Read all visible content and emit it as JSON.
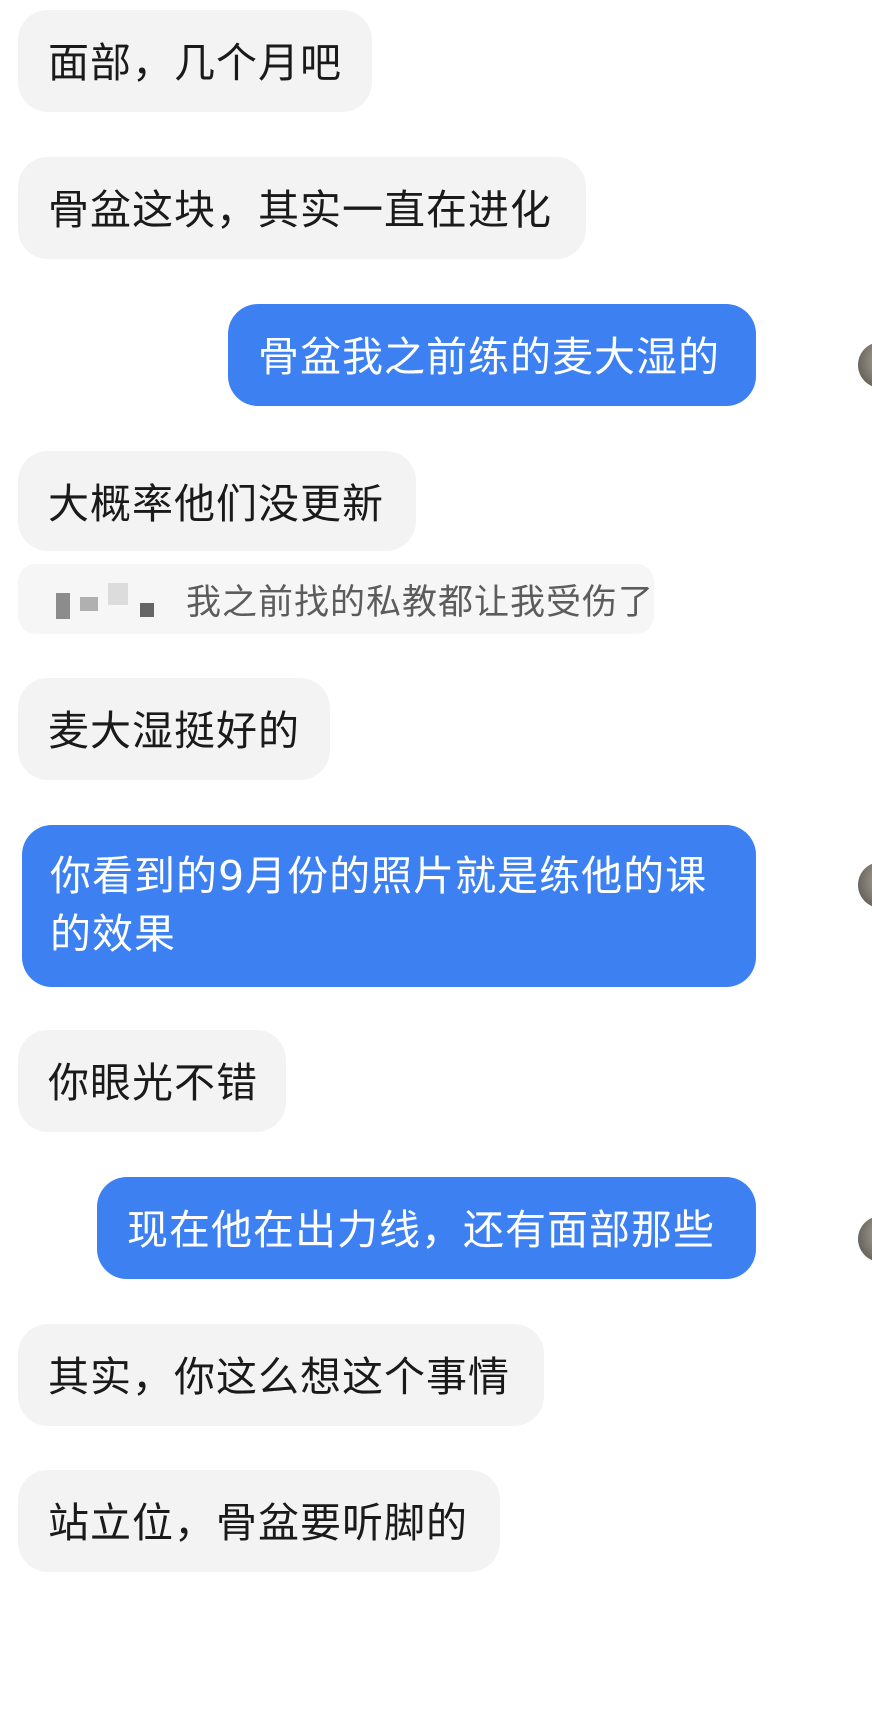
{
  "messages": [
    {
      "side": "in",
      "text": "面部，几个月吧"
    },
    {
      "side": "in",
      "text": "骨盆这块，其实一直在进化"
    },
    {
      "side": "out",
      "text": "骨盆我之前练的麦大湿的"
    },
    {
      "side": "in",
      "text": "大概率他们没更新"
    },
    {
      "side": "quote",
      "text": "我之前找的私教都让我受伤了"
    },
    {
      "side": "in",
      "text": "麦大湿挺好的"
    },
    {
      "side": "out",
      "text": "你看到的9月份的照片就是练他的课的效果"
    },
    {
      "side": "in",
      "text": "你眼光不错"
    },
    {
      "side": "out",
      "text": "现在他在出力线，还有面部那些"
    },
    {
      "side": "in",
      "text": "其实，你这么想这个事情"
    },
    {
      "side": "in",
      "text": "站立位，骨盆要听脚的"
    }
  ],
  "colors": {
    "incoming_bubble": "#f3f3f3",
    "outgoing_bubble": "#3d80f1",
    "incoming_text": "#1a1a1a",
    "outgoing_text": "#ffffff",
    "quote_text": "#5c5c5c",
    "background": "#ffffff"
  },
  "icons": {
    "avatar": "user-avatar",
    "quote_sender": "pixelated-name"
  }
}
